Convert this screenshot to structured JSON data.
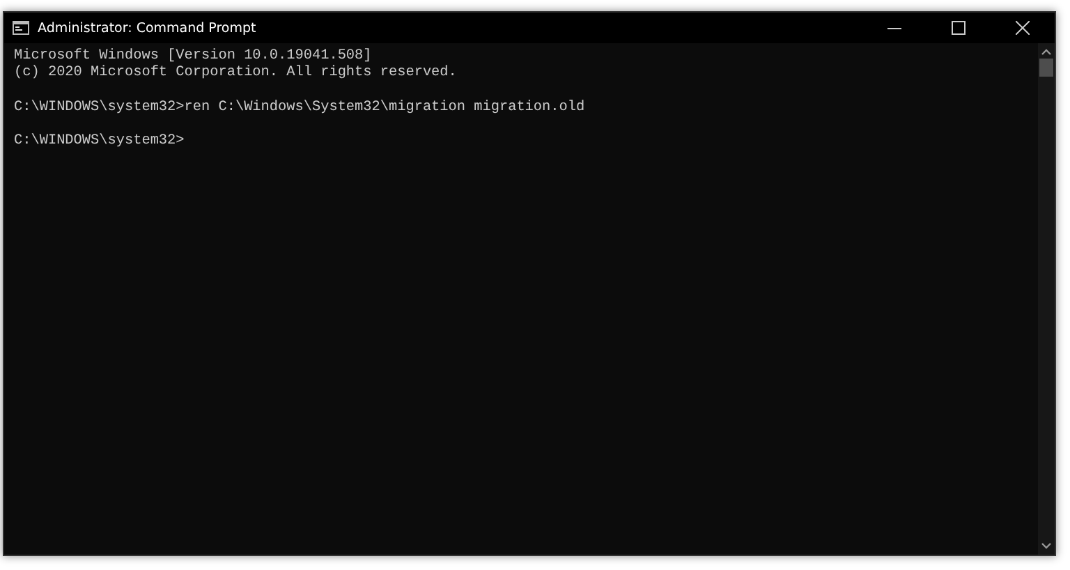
{
  "window": {
    "title": "Administrator: Command Prompt"
  },
  "console": {
    "blocks": [
      [
        "Microsoft Windows [Version 10.0.19041.508]",
        "(c) 2020 Microsoft Corporation. All rights reserved."
      ],
      [
        "C:\\WINDOWS\\system32>ren C:\\Windows\\System32\\migration migration.old"
      ],
      [
        "C:\\WINDOWS\\system32>"
      ]
    ]
  }
}
